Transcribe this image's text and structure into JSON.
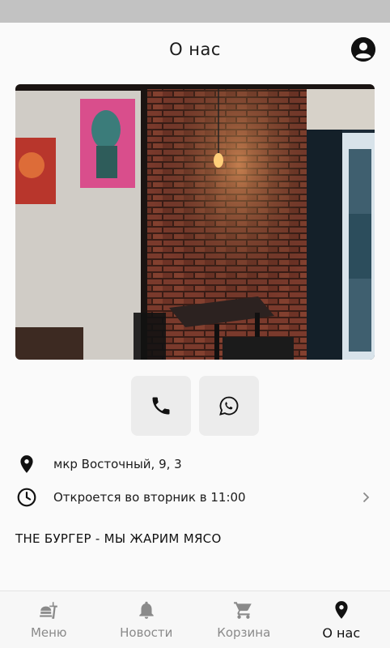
{
  "header": {
    "title": "О нас",
    "profile_icon": "account-circle-icon"
  },
  "contacts": {
    "phone_icon": "phone-icon",
    "whatsapp_icon": "whatsapp-icon"
  },
  "info": {
    "address": "мкр Восточный, 9, 3",
    "hours": "Откроется во вторник в 11:00"
  },
  "tagline": "THE БУРГЕР - МЫ ЖАРИМ МЯСО",
  "nav": {
    "items": [
      {
        "label": "Меню",
        "icon": "food-icon"
      },
      {
        "label": "Новости",
        "icon": "bell-icon"
      },
      {
        "label": "Корзина",
        "icon": "cart-icon"
      },
      {
        "label": "О нас",
        "icon": "location-pin-icon"
      }
    ],
    "active_index": 3
  },
  "colors": {
    "accent": "#111111",
    "inactive": "#8a8a8a",
    "button_bg": "#ececec"
  }
}
